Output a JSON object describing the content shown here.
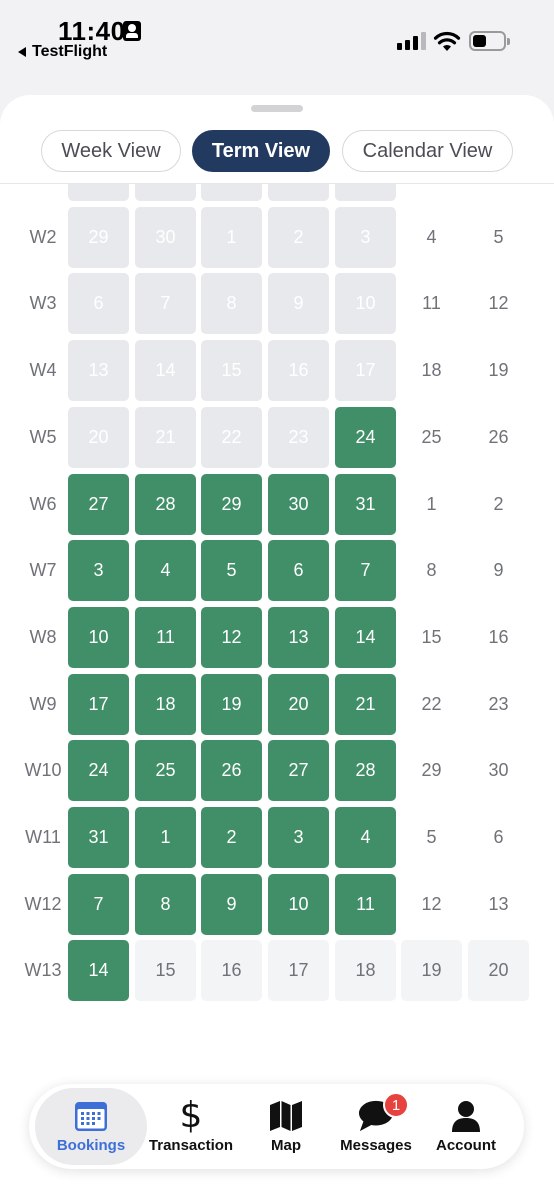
{
  "status_bar": {
    "time": "11:40",
    "back_label": "TestFlight"
  },
  "view_tabs": [
    {
      "label": "Week View",
      "active": false
    },
    {
      "label": "Term View",
      "active": true
    },
    {
      "label": "Calendar View",
      "active": false
    }
  ],
  "weeks": [
    {
      "label": "",
      "days": [
        [
          "",
          "past"
        ],
        [
          "",
          "past"
        ],
        [
          "",
          "past"
        ],
        [
          "",
          "past"
        ],
        [
          "",
          "past"
        ],
        [
          "",
          "plain"
        ],
        [
          "",
          "plain"
        ]
      ]
    },
    {
      "label": "W2",
      "days": [
        [
          "29",
          "past"
        ],
        [
          "30",
          "past"
        ],
        [
          "1",
          "past"
        ],
        [
          "2",
          "past"
        ],
        [
          "3",
          "past"
        ],
        [
          "4",
          "plain"
        ],
        [
          "5",
          "plain"
        ]
      ]
    },
    {
      "label": "W3",
      "days": [
        [
          "6",
          "past"
        ],
        [
          "7",
          "past"
        ],
        [
          "8",
          "past"
        ],
        [
          "9",
          "past"
        ],
        [
          "10",
          "past"
        ],
        [
          "11",
          "plain"
        ],
        [
          "12",
          "plain"
        ]
      ]
    },
    {
      "label": "W4",
      "days": [
        [
          "13",
          "past"
        ],
        [
          "14",
          "past"
        ],
        [
          "15",
          "past"
        ],
        [
          "16",
          "past"
        ],
        [
          "17",
          "past"
        ],
        [
          "18",
          "plain"
        ],
        [
          "19",
          "plain"
        ]
      ]
    },
    {
      "label": "W5",
      "days": [
        [
          "20",
          "past"
        ],
        [
          "21",
          "past"
        ],
        [
          "22",
          "past"
        ],
        [
          "23",
          "past"
        ],
        [
          "24",
          "booked"
        ],
        [
          "25",
          "plain"
        ],
        [
          "26",
          "plain"
        ]
      ]
    },
    {
      "label": "W6",
      "days": [
        [
          "27",
          "booked"
        ],
        [
          "28",
          "booked"
        ],
        [
          "29",
          "booked"
        ],
        [
          "30",
          "booked"
        ],
        [
          "31",
          "booked"
        ],
        [
          "1",
          "plain"
        ],
        [
          "2",
          "plain"
        ]
      ]
    },
    {
      "label": "W7",
      "days": [
        [
          "3",
          "booked"
        ],
        [
          "4",
          "booked"
        ],
        [
          "5",
          "booked"
        ],
        [
          "6",
          "booked"
        ],
        [
          "7",
          "booked"
        ],
        [
          "8",
          "plain"
        ],
        [
          "9",
          "plain"
        ]
      ]
    },
    {
      "label": "W8",
      "days": [
        [
          "10",
          "booked"
        ],
        [
          "11",
          "booked"
        ],
        [
          "12",
          "booked"
        ],
        [
          "13",
          "booked"
        ],
        [
          "14",
          "booked"
        ],
        [
          "15",
          "plain"
        ],
        [
          "16",
          "plain"
        ]
      ]
    },
    {
      "label": "W9",
      "days": [
        [
          "17",
          "booked"
        ],
        [
          "18",
          "booked"
        ],
        [
          "19",
          "booked"
        ],
        [
          "20",
          "booked"
        ],
        [
          "21",
          "booked"
        ],
        [
          "22",
          "plain"
        ],
        [
          "23",
          "plain"
        ]
      ]
    },
    {
      "label": "W10",
      "days": [
        [
          "24",
          "booked"
        ],
        [
          "25",
          "booked"
        ],
        [
          "26",
          "booked"
        ],
        [
          "27",
          "booked"
        ],
        [
          "28",
          "booked"
        ],
        [
          "29",
          "plain"
        ],
        [
          "30",
          "plain"
        ]
      ]
    },
    {
      "label": "W11",
      "days": [
        [
          "31",
          "booked"
        ],
        [
          "1",
          "booked"
        ],
        [
          "2",
          "booked"
        ],
        [
          "3",
          "booked"
        ],
        [
          "4",
          "booked"
        ],
        [
          "5",
          "plain"
        ],
        [
          "6",
          "plain"
        ]
      ]
    },
    {
      "label": "W12",
      "days": [
        [
          "7",
          "booked"
        ],
        [
          "8",
          "booked"
        ],
        [
          "9",
          "booked"
        ],
        [
          "10",
          "booked"
        ],
        [
          "11",
          "booked"
        ],
        [
          "12",
          "plain"
        ],
        [
          "13",
          "plain"
        ]
      ]
    },
    {
      "label": "W13",
      "days": [
        [
          "14",
          "booked"
        ],
        [
          "15",
          "future"
        ],
        [
          "16",
          "future"
        ],
        [
          "17",
          "future"
        ],
        [
          "18",
          "future"
        ],
        [
          "19",
          "future"
        ],
        [
          "20",
          "future"
        ]
      ]
    }
  ],
  "nav": {
    "bookings": "Bookings",
    "transaction": "Transaction",
    "map": "Map",
    "messages": "Messages",
    "messages_badge": "1",
    "account": "Account",
    "active": "bookings"
  },
  "colors": {
    "primary_navy": "#233a60",
    "booked_green": "#418f68",
    "active_blue": "#3e6fd6",
    "badge_red": "#e8423f"
  },
  "icons": {
    "bookings": "calendar-icon",
    "transaction": "dollar-icon",
    "map": "map-icon",
    "messages": "chat-bubble-icon",
    "account": "person-icon"
  }
}
